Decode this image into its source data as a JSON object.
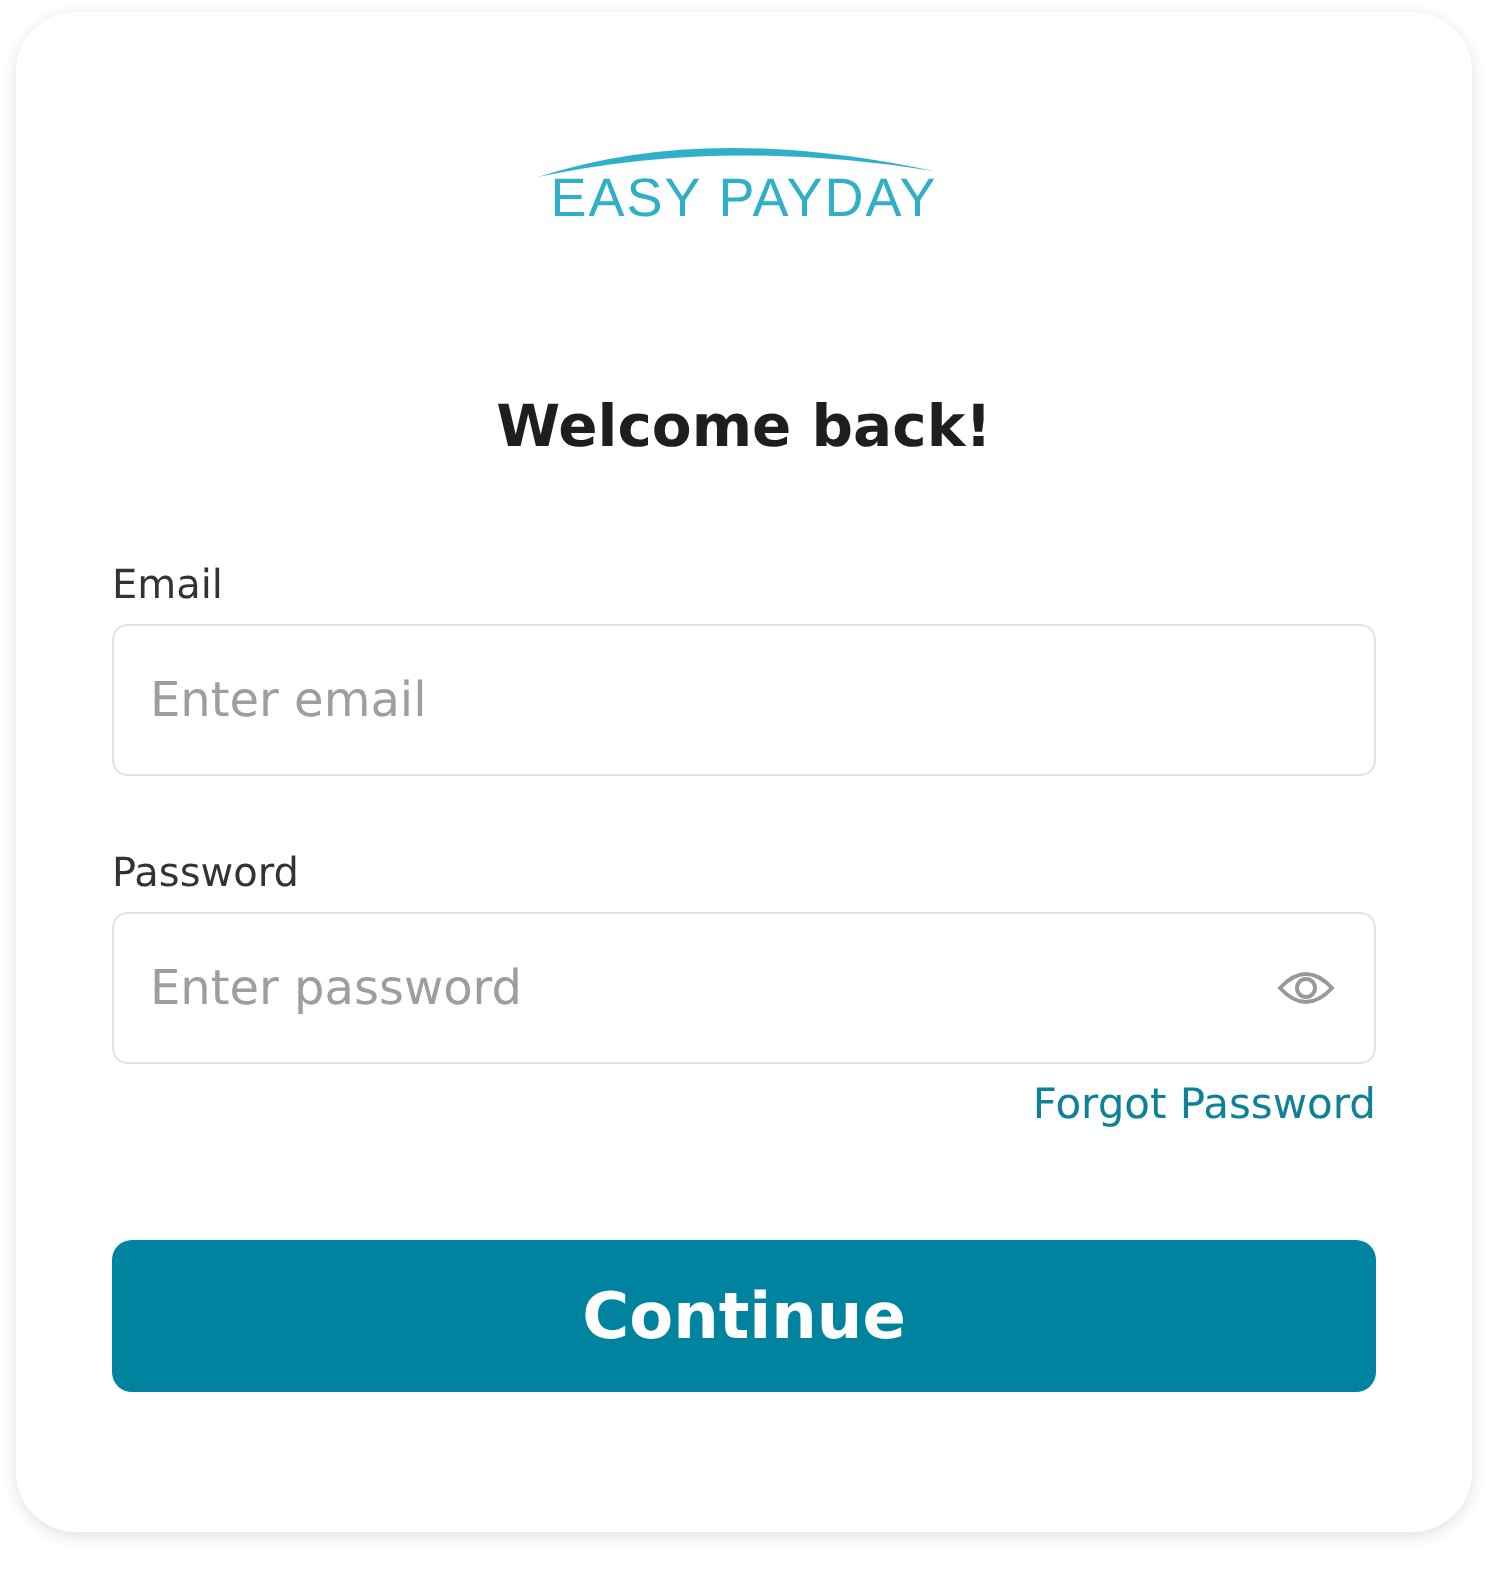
{
  "logo": {
    "text": "EASY PAYDAY"
  },
  "heading": "Welcome back!",
  "fields": [
    {
      "label": "Email",
      "placeholder": "Enter email",
      "kind": "text"
    },
    {
      "label": "Password",
      "placeholder": "Enter password",
      "kind": "password"
    }
  ],
  "forgot_link": "Forgot Password",
  "submit_button": "Continue"
}
